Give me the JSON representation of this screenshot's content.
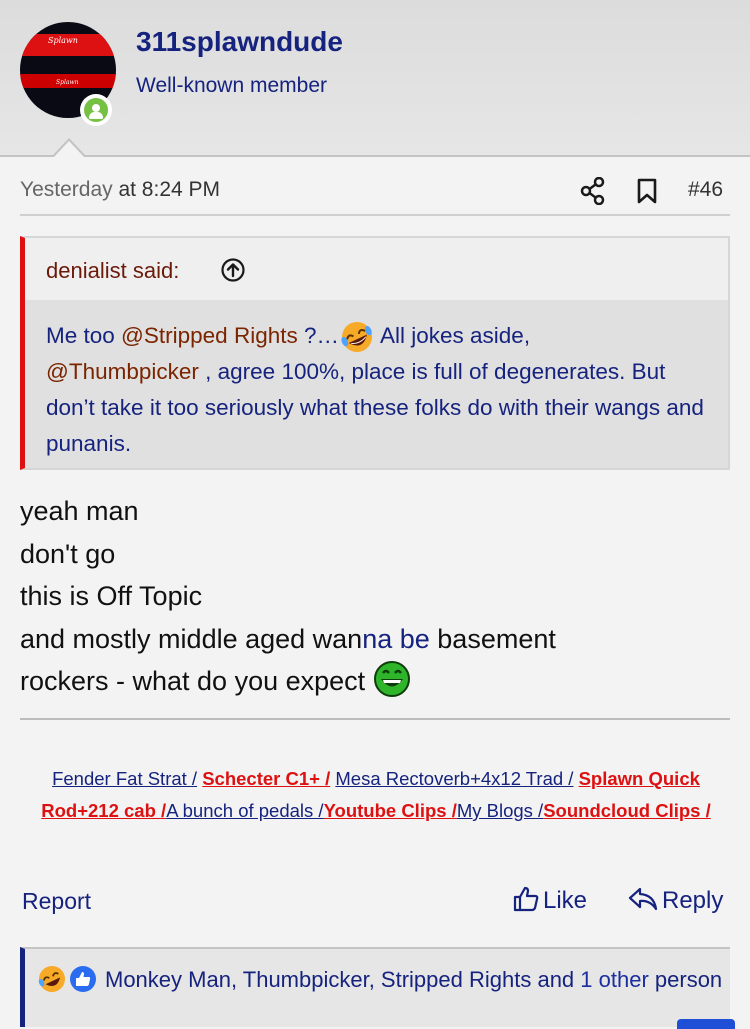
{
  "user": {
    "name": "311splawndude",
    "title": "Well-known member",
    "avatar_text_top": "Splawn",
    "avatar_text_bottom": "Splawn"
  },
  "post": {
    "date_word": "Yesterday",
    "time": " at 8:24 PM",
    "number": "#46"
  },
  "quote": {
    "author": "denialist said:",
    "line1_pre": "Me too ",
    "mention1": "@Stripped Rights",
    "line1_post": " ?…",
    "line1_after_emoji": " All jokes aside,",
    "mention2": "@Thumbpicker",
    "rest": " , agree 100%, place is full of degenerates. But don’t take it too seriously what these folks do with their wangs and punanis."
  },
  "body": {
    "line1": "yeah man",
    "line2": "don't go",
    "line3": "this is Off Topic",
    "line4_a": "and mostly middle aged wan",
    "line4_b": "na be",
    "line4_c": " basement",
    "line5": "rockers - what do you expect "
  },
  "signature": {
    "link1": "Fender Fat Strat /",
    "link2": "Schecter C1+ /",
    "link3": "Mesa Rectoverb+4x12 Trad /",
    "link4": "Splawn Quick Rod+212 cab /",
    "link5": "A bunch of pedals /",
    "link6": "Youtube Clips /",
    "link7": "My Blogs /",
    "link8": "Soundcloud Clips /"
  },
  "actions": {
    "report": "Report",
    "like": "Like",
    "reply": "Reply"
  },
  "reactions": {
    "text": "Monkey Man, Thumbpicker, Stripped Rights and ",
    "more": "1 other",
    "tail": " person"
  },
  "colors": {
    "accent_blue": "#16237e",
    "quote_border_red": "#dd1111",
    "online_green": "#76c043"
  }
}
